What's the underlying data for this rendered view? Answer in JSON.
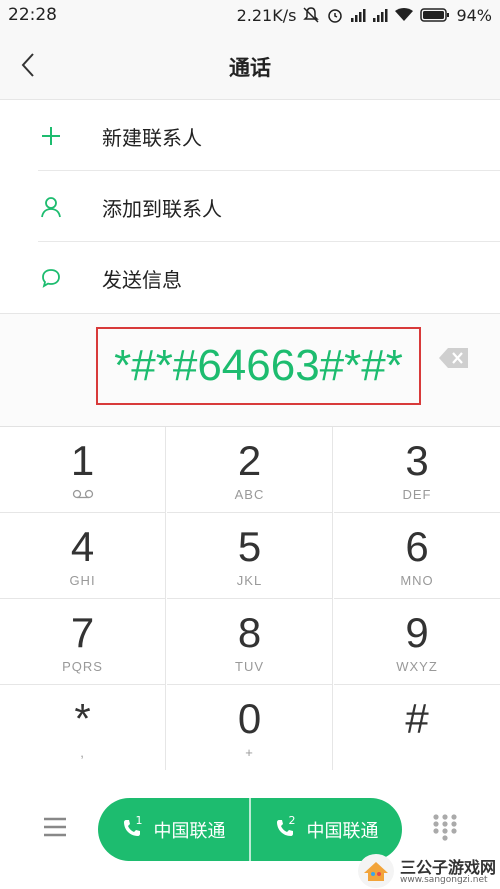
{
  "status_bar": {
    "time": "22:28",
    "net_speed": "2.21K/s",
    "battery": "94%"
  },
  "header": {
    "title": "通话"
  },
  "actions": [
    {
      "label": "新建联系人",
      "icon": "plus-icon"
    },
    {
      "label": "添加到联系人",
      "icon": "person-icon"
    },
    {
      "label": "发送信息",
      "icon": "message-icon"
    }
  ],
  "dialer": {
    "digits": "*#*#64663#*#*"
  },
  "keypad": {
    "keys": [
      {
        "digit": "1",
        "sub": ""
      },
      {
        "digit": "2",
        "sub": "ABC"
      },
      {
        "digit": "3",
        "sub": "DEF"
      },
      {
        "digit": "4",
        "sub": "GHI"
      },
      {
        "digit": "5",
        "sub": "JKL"
      },
      {
        "digit": "6",
        "sub": "MNO"
      },
      {
        "digit": "7",
        "sub": "PQRS"
      },
      {
        "digit": "8",
        "sub": "TUV"
      },
      {
        "digit": "9",
        "sub": "WXYZ"
      },
      {
        "digit": "*",
        "sub": ","
      },
      {
        "digit": "0",
        "sub": "+"
      },
      {
        "digit": "#",
        "sub": ""
      }
    ]
  },
  "call_buttons": [
    {
      "label": "中国联通",
      "sim": "1"
    },
    {
      "label": "中国联通",
      "sim": "2"
    }
  ],
  "watermark": {
    "title": "三公子游戏网",
    "url": "www.sangongzi.net"
  },
  "colors": {
    "accent": "#1dbc6f",
    "highlight_box": "#d83a3a"
  }
}
